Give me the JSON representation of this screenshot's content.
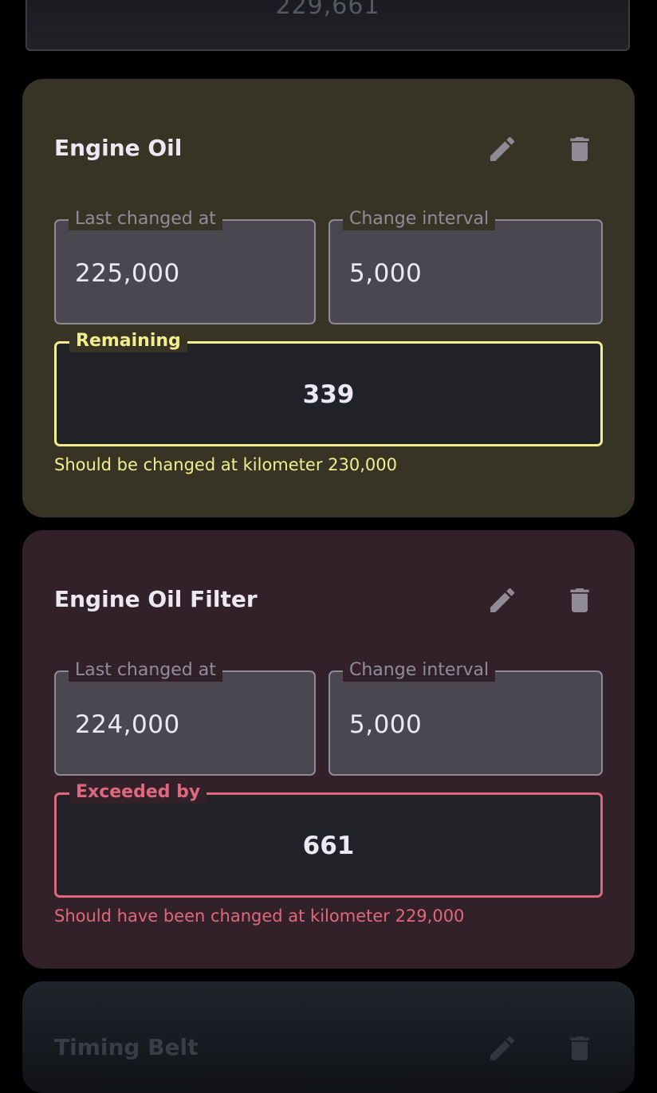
{
  "top_card": {
    "value": "229,661"
  },
  "cards": [
    {
      "title": "Engine Oil",
      "edit_icon": "pencil-icon",
      "delete_icon": "trash-icon",
      "last_changed": {
        "label": "Last changed at",
        "value": "225,000"
      },
      "interval": {
        "label": "Change interval",
        "value": "5,000"
      },
      "status": {
        "label": "Remaining",
        "value": "339",
        "color": "#f2ee8e"
      },
      "helper": "Should be changed at kilometer 230,000",
      "background": "#383425"
    },
    {
      "title": "Engine Oil Filter",
      "edit_icon": "pencil-icon",
      "delete_icon": "trash-icon",
      "last_changed": {
        "label": "Last changed at",
        "value": "224,000"
      },
      "interval": {
        "label": "Change interval",
        "value": "5,000"
      },
      "status": {
        "label": "Exceeded by",
        "value": "661",
        "color": "#e0687c"
      },
      "helper": "Should have been changed at kilometer 229,000",
      "background": "#33212a"
    }
  ],
  "bottom_card": {
    "title": "Timing Belt"
  }
}
